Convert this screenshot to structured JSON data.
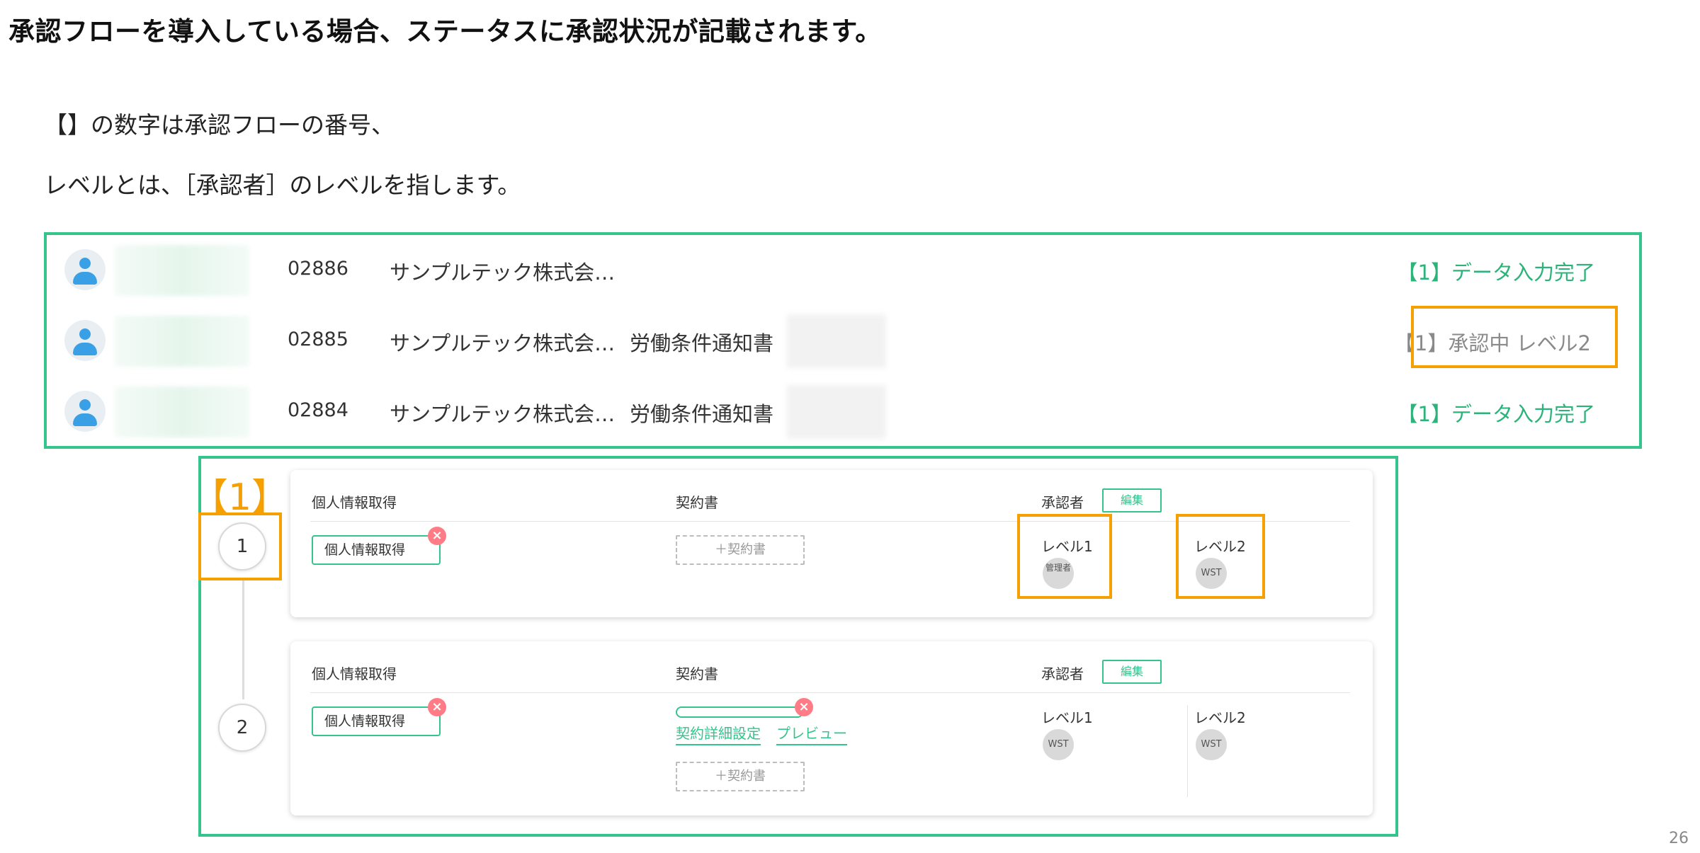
{
  "heading": "承認フローを導入している場合、ステータスに承認状況が記載されます。",
  "notes": {
    "line1": "【】の数字は承認フローの番号、",
    "line2": "レベルとは、［承認者］のレベルを指します。"
  },
  "employee_list": {
    "rows": [
      {
        "code": "02886",
        "company": "サンプルテック株式会…",
        "document": "",
        "status": "【1】データ入力完了"
      },
      {
        "code": "02885",
        "company": "サンプルテック株式会…",
        "document": "労働条件通知書",
        "status": "【1】承認中 レベル2"
      },
      {
        "code": "02884",
        "company": "サンプルテック株式会…",
        "document": "労働条件通知書",
        "status": "【1】データ入力完了"
      }
    ]
  },
  "flow": {
    "badge": "【1】",
    "steps": [
      {
        "number": "1",
        "col_personal": "個人情報取得",
        "col_contract": "契約書",
        "col_approver": "承認者",
        "edit_label": "編集",
        "tag": "個人情報取得",
        "add_contract": "＋契約書",
        "level1_label": "レベル1",
        "level1_avatar": "管理者",
        "level2_label": "レベル2",
        "level2_avatar": "WST"
      },
      {
        "number": "2",
        "col_personal": "個人情報取得",
        "col_contract": "契約書",
        "col_approver": "承認者",
        "edit_label": "編集",
        "tag": "個人情報取得",
        "contract_settings_link": "契約詳細設定",
        "preview_link": "プレビュー",
        "add_contract": "＋契約書",
        "level1_label": "レベル1",
        "level1_avatar": "WST",
        "level2_label": "レベル2",
        "level2_avatar": "WST"
      }
    ]
  },
  "page_number": "26",
  "colors": {
    "accent_green": "#34c48c",
    "highlight_orange": "#f5a000",
    "remove_red": "#ff7b86"
  }
}
